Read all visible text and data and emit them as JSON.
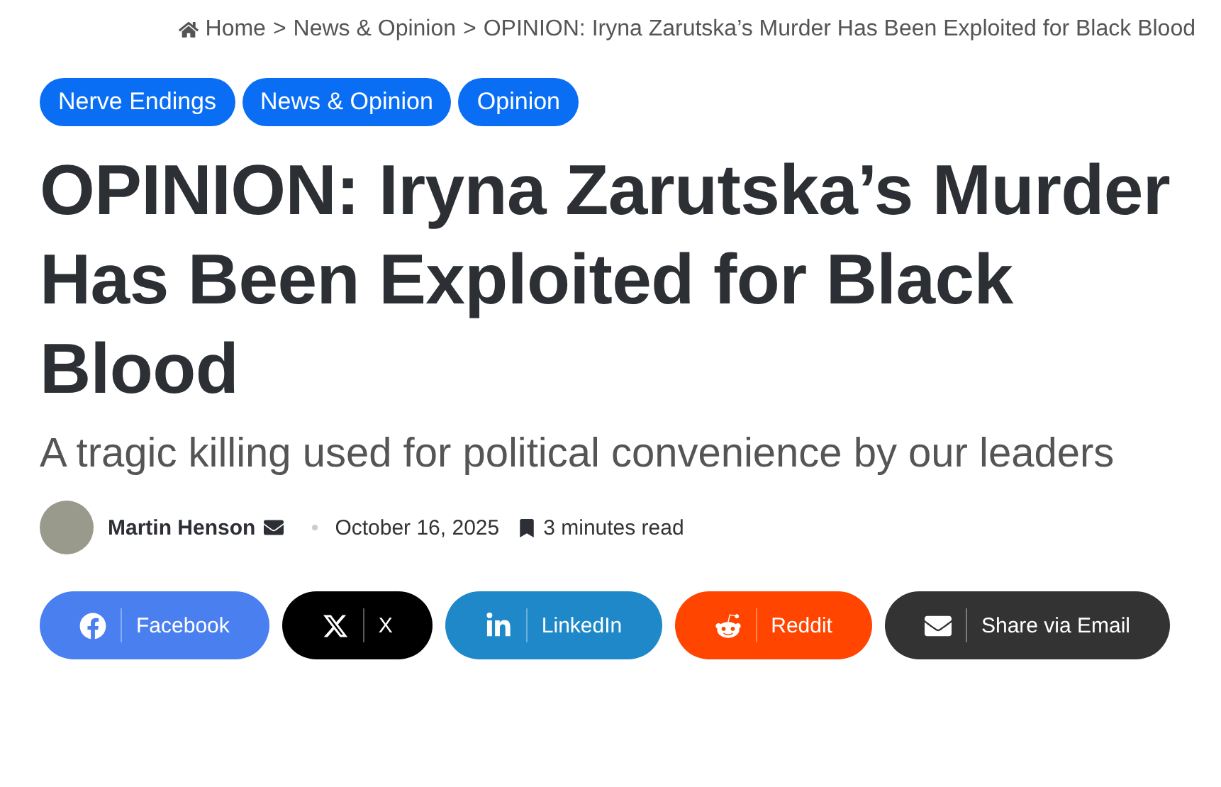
{
  "breadcrumb": {
    "items": [
      "Home",
      "News & Opinion",
      "OPINION: Iryna Zarutska’s Murder Has Been Exploited for Black Blood"
    ],
    "separator": ">"
  },
  "categories": [
    "Nerve Endings",
    "News & Opinion",
    "Opinion"
  ],
  "title": "OPINION: Iryna Zarutska’s Murder Has Been Exploited for Black Blood",
  "subtitle": "A tragic killing used for political convenience by our leaders",
  "meta": {
    "author": "Martin Henson",
    "date": "October 16, 2025",
    "read_time": "3 minutes read"
  },
  "share": [
    {
      "kind": "facebook",
      "label": "Facebook",
      "color": "#4a7ff0"
    },
    {
      "kind": "x",
      "label": "X",
      "color": "#000000"
    },
    {
      "kind": "linkedin",
      "label": "LinkedIn",
      "color": "#1e88c8"
    },
    {
      "kind": "reddit",
      "label": "Reddit",
      "color": "#ff4500"
    },
    {
      "kind": "email",
      "label": "Share via Email",
      "color": "#333333"
    }
  ]
}
